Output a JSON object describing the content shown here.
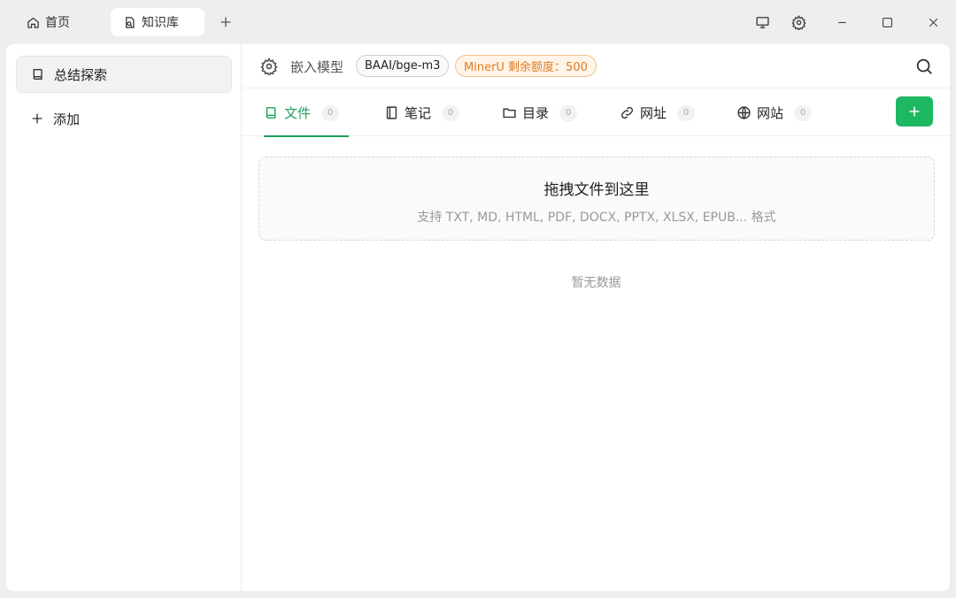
{
  "titlebar": {
    "tabs": [
      {
        "label": "首页",
        "icon": "home-icon"
      },
      {
        "label": "知识库",
        "icon": "knowledge-file-icon"
      }
    ],
    "add_tab_icon": "plus-icon",
    "controls": [
      "monitor-icon",
      "gear-icon",
      "minimize-icon",
      "maximize-icon",
      "close-icon"
    ]
  },
  "sidebar": {
    "items": [
      {
        "label": "总结探索",
        "icon": "book-icon"
      },
      {
        "label": "添加",
        "icon": "plus-icon"
      }
    ]
  },
  "topbar": {
    "embed_label": "嵌入模型",
    "model": "BAAI/bge-m3",
    "quota": "MinerU 剩余额度：500",
    "search_icon": "search-icon"
  },
  "tabs": [
    {
      "label": "文件",
      "count": "0",
      "icon": "book-icon"
    },
    {
      "label": "笔记",
      "count": "0",
      "icon": "notebook-icon"
    },
    {
      "label": "目录",
      "count": "0",
      "icon": "folder-icon"
    },
    {
      "label": "网址",
      "count": "0",
      "icon": "link-icon"
    },
    {
      "label": "网站",
      "count": "0",
      "icon": "globe-icon"
    }
  ],
  "dropzone": {
    "title": "拖拽文件到这里",
    "subtitle": "支持 TXT, MD, HTML, PDF, DOCX, PPTX, XLSX, EPUB... 格式"
  },
  "empty_text": "暂无数据",
  "colors": {
    "accent": "#1fb862",
    "active_tab": "#1fa35c",
    "quota": "#e07b20"
  }
}
